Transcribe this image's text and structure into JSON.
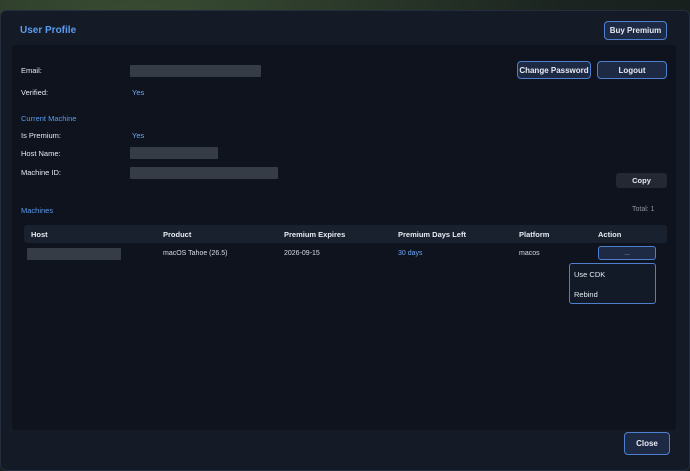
{
  "dialog": {
    "title": "User Profile",
    "buy_premium_label": "Buy Premium",
    "close_label": "Close"
  },
  "account": {
    "email_label": "Email:",
    "verified_label": "Verified:",
    "verified_value": "Yes",
    "change_password_label": "Change Password",
    "logout_label": "Logout"
  },
  "current_machine": {
    "section_title": "Current Machine",
    "is_premium_label": "Is Premium:",
    "is_premium_value": "Yes",
    "host_name_label": "Host Name:",
    "machine_id_label": "Machine ID:",
    "copy_label": "Copy"
  },
  "machines": {
    "section_title": "Machines",
    "total": "Total: 1",
    "columns": {
      "host": "Host",
      "product": "Product",
      "premium_expires": "Premium Expires",
      "premium_days_left": "Premium Days Left",
      "platform": "Platform",
      "action": "Action"
    },
    "rows": [
      {
        "product": "macOS Tahoe (26.5)",
        "premium_expires": "2026-09-15",
        "premium_days_left": "30 days",
        "platform": "macos",
        "action": "..."
      }
    ],
    "action_menu": [
      "Use CDK",
      "Rebind"
    ]
  },
  "colors": {
    "accent": "#5b9bf0",
    "panel": "#0e131d",
    "dialog": "#141b27",
    "button_border": "#4f7fcf"
  }
}
